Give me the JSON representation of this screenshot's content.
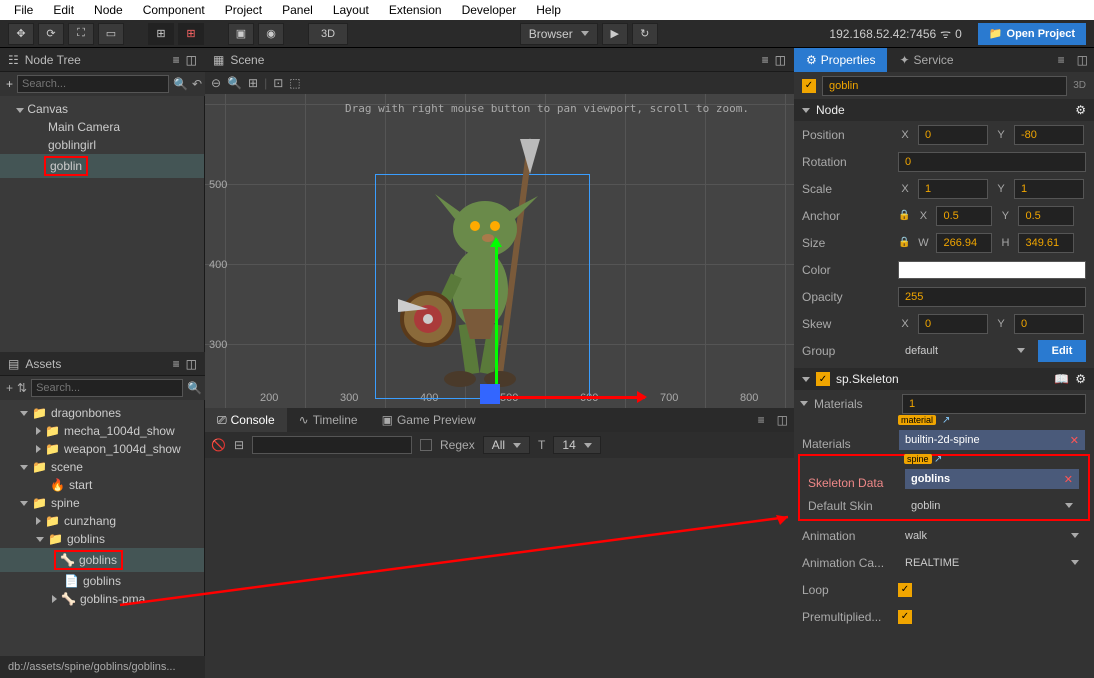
{
  "menu": [
    "File",
    "Edit",
    "Node",
    "Component",
    "Project",
    "Panel",
    "Layout",
    "Extension",
    "Developer",
    "Help"
  ],
  "toolbar": {
    "mode3d": "3D",
    "browser": "Browser",
    "ip": "192.168.52.42:7456",
    "conn": "0",
    "open_project": "Open Project"
  },
  "node_tree": {
    "title": "Node Tree",
    "search_ph": "Search...",
    "root": "Canvas",
    "items": [
      "Main Camera",
      "goblingirl",
      "goblin"
    ]
  },
  "assets": {
    "title": "Assets",
    "search_ph": "Search...",
    "items": [
      {
        "indent": 0,
        "icon": "folder",
        "label": "dragonbones",
        "open": true,
        "arrow": "down"
      },
      {
        "indent": 1,
        "icon": "folder",
        "label": "mecha_1004d_show",
        "arrow": "right"
      },
      {
        "indent": 1,
        "icon": "folder",
        "label": "weapon_1004d_show",
        "arrow": "right"
      },
      {
        "indent": 0,
        "icon": "folder",
        "label": "scene",
        "open": true,
        "arrow": "down"
      },
      {
        "indent": 1,
        "icon": "fire",
        "label": "start"
      },
      {
        "indent": 0,
        "icon": "folder",
        "label": "spine",
        "open": true,
        "arrow": "down"
      },
      {
        "indent": 1,
        "icon": "folder",
        "label": "cunzhang",
        "arrow": "right"
      },
      {
        "indent": 1,
        "icon": "folder",
        "label": "goblins",
        "open": true,
        "arrow": "down"
      },
      {
        "indent": 2,
        "icon": "spine",
        "label": "goblins",
        "highlight": true
      },
      {
        "indent": 2,
        "icon": "file",
        "label": "goblins"
      },
      {
        "indent": 2,
        "icon": "spine",
        "label": "goblins-pma",
        "arrow": "right"
      }
    ],
    "status": "db://assets/spine/goblins/goblins..."
  },
  "scene": {
    "title": "Scene",
    "hint": "Drag with right mouse button to pan viewport, scroll to zoom.",
    "xticks": [
      "200",
      "300",
      "400",
      "500",
      "600",
      "700",
      "800"
    ],
    "yticks": [
      "500",
      "400",
      "300"
    ]
  },
  "console": {
    "tabs": [
      "Console",
      "Timeline",
      "Game Preview"
    ],
    "regex": "Regex",
    "all": "All",
    "fontsize": "14"
  },
  "props": {
    "title_properties": "Properties",
    "title_service": "Service",
    "node_name": "goblin",
    "badge3d": "3D",
    "section_node": "Node",
    "section_skeleton": "sp.Skeleton",
    "position": "Position",
    "pos_x": "0",
    "pos_y": "-80",
    "rotation": "Rotation",
    "rot": "0",
    "scale": "Scale",
    "scale_x": "1",
    "scale_y": "1",
    "anchor": "Anchor",
    "anchor_x": "0.5",
    "anchor_y": "0.5",
    "size": "Size",
    "size_w": "266.94",
    "size_h": "349.61",
    "color": "Color",
    "opacity": "Opacity",
    "opacity_v": "255",
    "skew": "Skew",
    "skew_x": "0",
    "skew_y": "0",
    "group": "Group",
    "group_v": "default",
    "edit": "Edit",
    "materials": "Materials",
    "materials_n": "1",
    "materials2": "Materials",
    "material_badge": "material",
    "material_v": "builtin-2d-spine",
    "skeleton_data": "Skeleton Data",
    "spine_badge": "spine",
    "skeleton_v": "goblins",
    "default_skin": "Default Skin",
    "skin_v": "goblin",
    "animation": "Animation",
    "anim_v": "walk",
    "anim_cache": "Animation Ca...",
    "cache_v": "REALTIME",
    "loop": "Loop",
    "premul": "Premultiplied..."
  }
}
